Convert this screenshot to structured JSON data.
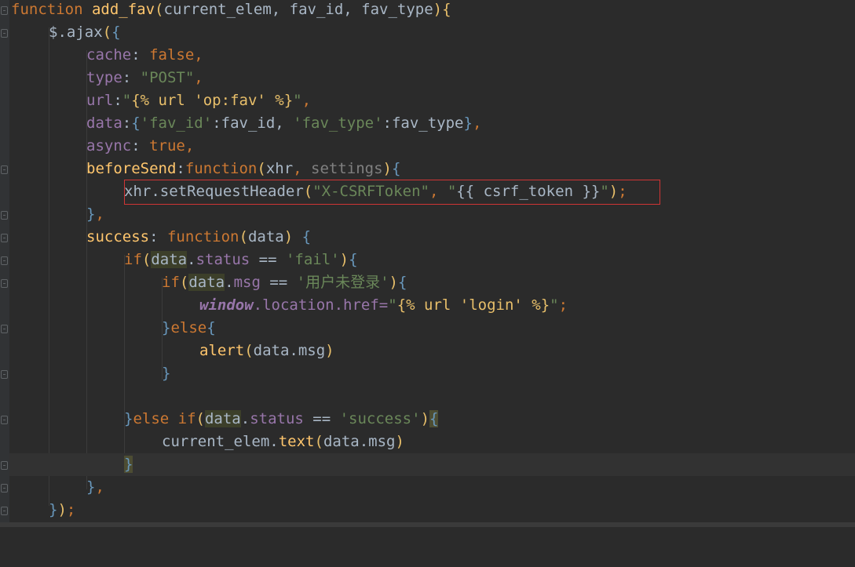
{
  "code": {
    "l1": {
      "kw": "function",
      "name": "add_fav",
      "p1": "(",
      "args": "current_elem, fav_id, fav_type",
      "p2": ")",
      "b": "{"
    },
    "l2": {
      "obj": "$.ajax",
      "p": "(",
      "b": "{"
    },
    "l3": {
      "key": "cache",
      "sep": ": ",
      "val": "false",
      "comma": ","
    },
    "l4": {
      "key": "type",
      "sep": ": ",
      "val": "\"POST\"",
      "comma": ","
    },
    "l5": {
      "key": "url",
      "sep": ":",
      "q1": "\"",
      "tpl": "{% url 'op:fav' %}",
      "q2": "\"",
      "comma": ","
    },
    "l6": {
      "key": "data",
      "sep": ":",
      "b1": "{",
      "s1": "'fav_id'",
      "c1": ":fav_id, ",
      "s2": "'fav_type'",
      "c2": ":fav_type",
      "b2": "}",
      "comma": ","
    },
    "l7": {
      "key": "async",
      "sep": ": ",
      "val": "true",
      "comma": ","
    },
    "l8": {
      "key": "beforeSend",
      "sep": ":",
      "kw": "function",
      "p1": "(",
      "a1": "xhr",
      "c": ", ",
      "a2": "settings",
      "p2": ")",
      "b": "{"
    },
    "l9": {
      "call": "xhr.setRequestHeader",
      "p1": "(",
      "s1": "\"X-CSRFToken\"",
      "c": ", ",
      "q1": "\"",
      "tpl": "{{ csrf_token }}",
      "q2": "\"",
      "p2": ")",
      "semi": ";"
    },
    "l10": {
      "b": "}",
      "comma": ","
    },
    "l11": {
      "key": "success",
      "sep": ": ",
      "kw": "function",
      "p1": "(",
      "a": "data",
      "p2": ")",
      "b": " {"
    },
    "l12": {
      "kw": "if",
      "p1": "(",
      "obj": "data",
      "dot": ".",
      "prop": "status",
      "op": " == ",
      "s": "'fail'",
      "p2": ")",
      "b": "{"
    },
    "l13": {
      "kw": "if",
      "p1": "(",
      "obj": "data",
      "dot": ".",
      "prop": "msg",
      "op": " == ",
      "s": "'用户未登录'",
      "p2": ")",
      "b": "{"
    },
    "l14": {
      "win": "window",
      "path": ".location.href=",
      "q1": "\"",
      "tpl": "{% url 'login' %}",
      "q2": "\"",
      "semi": ";"
    },
    "l15": {
      "b": "}",
      "kw": "else",
      "b2": "{"
    },
    "l16": {
      "fn": "alert",
      "p1": "(",
      "arg": "data.msg",
      "p2": ")"
    },
    "l17": {
      "b": "}"
    },
    "l19": {
      "b": "}",
      "kw": "else if",
      "p1": "(",
      "obj": "data",
      "dot": ".",
      "prop": "status",
      "op": " == ",
      "s": "'success'",
      "p2": ")",
      "b2": "{"
    },
    "l20": {
      "obj": "current_elem.",
      "fn": "text",
      "p1": "(",
      "arg": "data.msg",
      "p2": ")"
    },
    "l21": {
      "b": "}"
    },
    "l22": {
      "b": "}",
      "comma": ","
    },
    "l23": {
      "b": "}",
      "p": ")",
      "semi": ";"
    }
  },
  "colors": {
    "background": "#2b2b2b",
    "keyword": "#cc7832",
    "function": "#ffc66d",
    "string": "#6a8759",
    "template": "#e8bf6a",
    "property": "#9876aa",
    "highlight_box": "#d03535"
  }
}
